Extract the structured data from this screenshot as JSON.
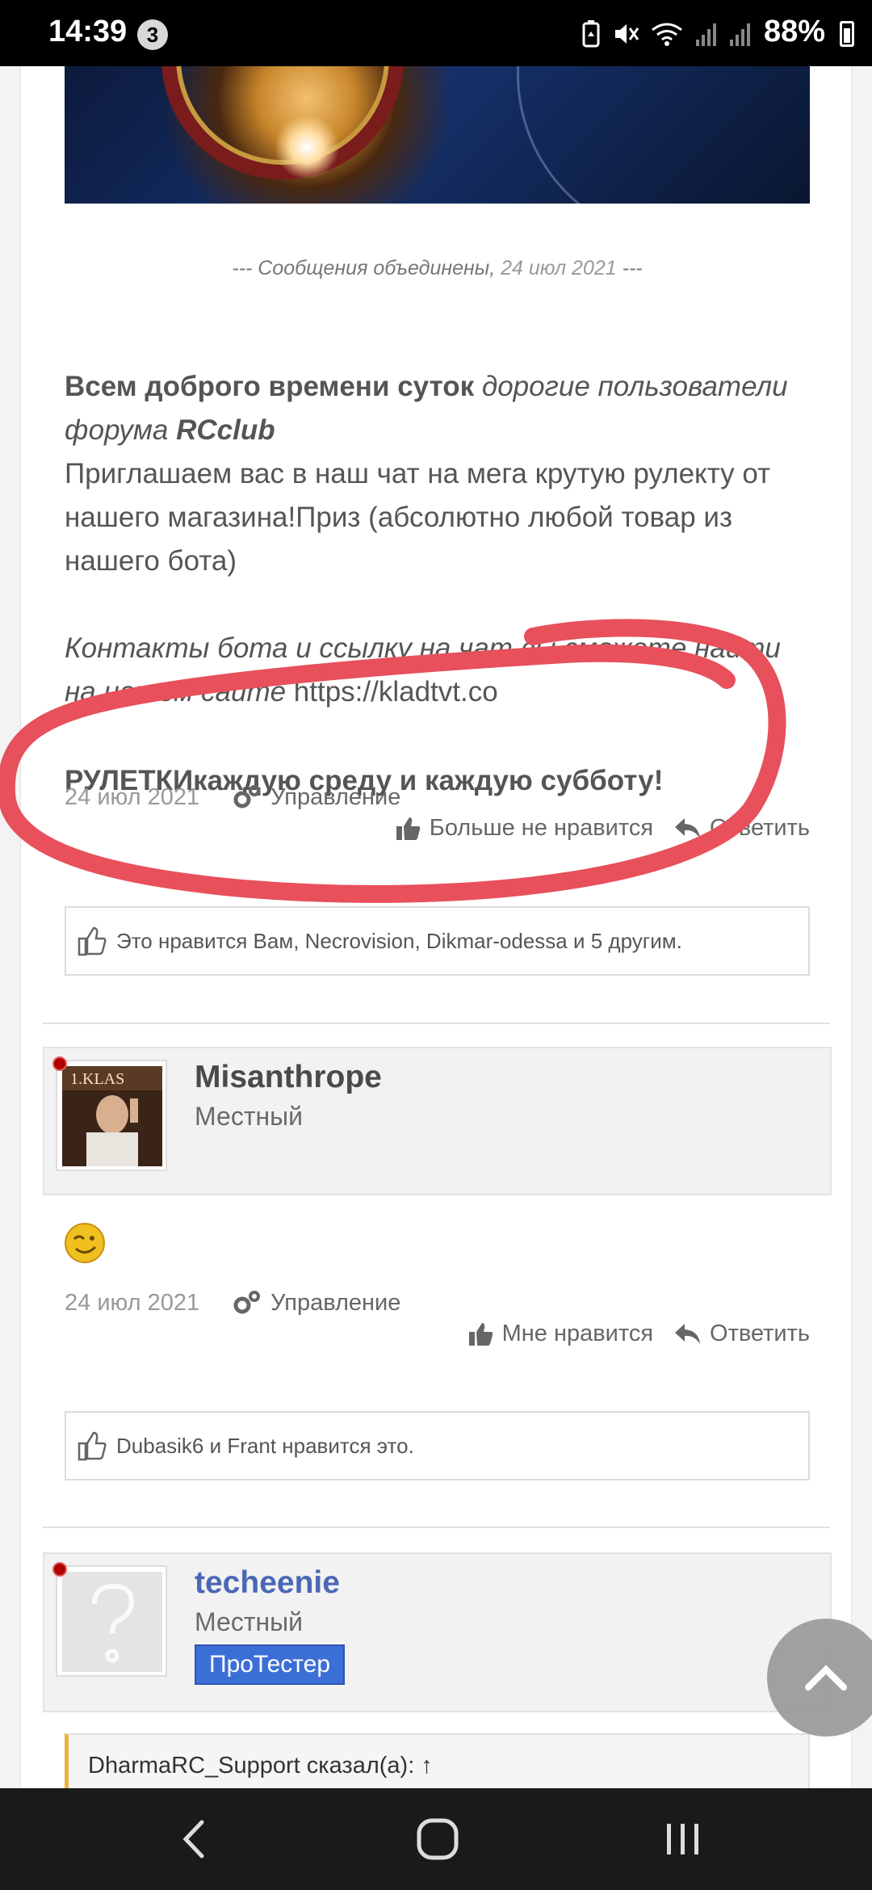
{
  "status_bar": {
    "time": "14:39",
    "notification_count": "3",
    "battery": "88%"
  },
  "post1": {
    "merged_note_prefix": "--- Сообщения объединены, ",
    "merged_note_date": "24 июл 2021",
    "merged_note_suffix": " ---",
    "greeting_bold": "Всем доброго времени суток",
    "greeting_italic": " дорогие пользователи форума ",
    "forum_name": "RCclub",
    "invite_text": "Приглашаем вас в наш чат на мега крутую рулекту от нашего магазина!Приз (абсолютно любой товар из нашего бота)",
    "contacts_italic": "Контакты бота и ссылку на чат вы сможете найти на нашем сайте ",
    "site_url": "https://kladtvt.co",
    "roulette_text": "РУЛЕТКИкаждую среду и каждую субботу!",
    "date": "24 июл 2021",
    "manage_label": "Управление",
    "unlike_label": "Больше не нравится",
    "reply_label": "Ответить",
    "likes_text": "Это нравится Вам, Necrovision, Dikmar-odessa и 5 другим."
  },
  "post2": {
    "username": "Misanthrope",
    "user_title": "Местный",
    "avatar_caption": "1.KLAS",
    "date": "24 июл 2021",
    "manage_label": "Управление",
    "like_label": "Мне нравится",
    "reply_label": "Ответить",
    "likes_text": "Dubasik6 и Frant нравится это."
  },
  "post3": {
    "username": "techeenie",
    "user_title": "Местный",
    "badge": "ПроТестер",
    "quote_text": "DharmaRC_Support сказал(а): ↑"
  },
  "colors": {
    "annotation": "#e8505b",
    "link_blue": "#4a68b5",
    "badge_blue": "#3c6fd6",
    "online_dot": "#b00000",
    "quote_accent": "#f0b040"
  },
  "icons": [
    "gear-icon",
    "thumbs-up-icon",
    "reply-icon",
    "like-outline-icon",
    "chevron-up-icon",
    "back-icon",
    "home-icon",
    "recents-icon",
    "smiley-wink-icon"
  ]
}
